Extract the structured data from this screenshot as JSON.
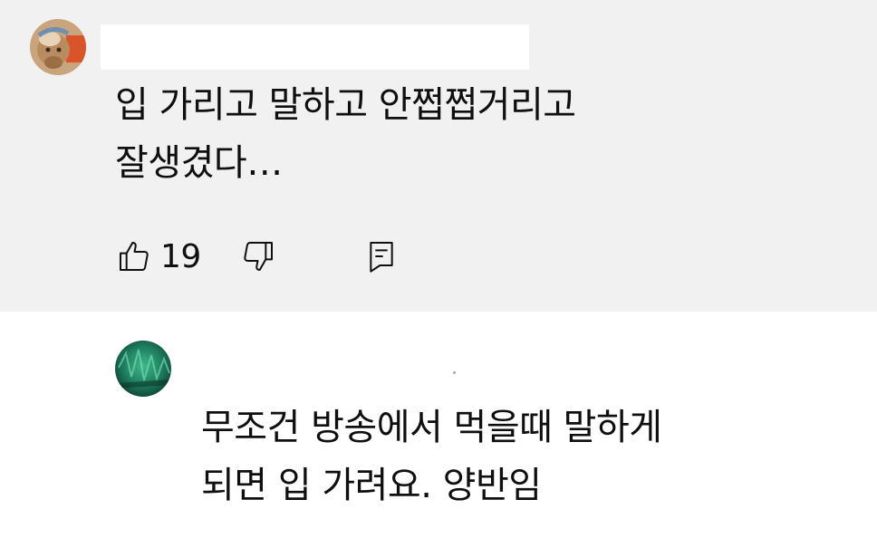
{
  "comment_1": {
    "author": "",
    "text_lines": [
      "입 가리고 말하고 안쩝쩝거리고",
      "잘생겼다…"
    ],
    "like_count": "19",
    "icons": {
      "like": "thumbs-up-icon",
      "dislike": "thumbs-down-icon",
      "reply": "reply-icon"
    }
  },
  "comment_2": {
    "text_lines": [
      "무조건 방송에서 먹을때 말하게",
      "되면 입 가려요. 양반임"
    ]
  },
  "colors": {
    "top_background": "#f1f1f1",
    "bottom_background": "#ffffff",
    "text": "#0f0f0f"
  }
}
